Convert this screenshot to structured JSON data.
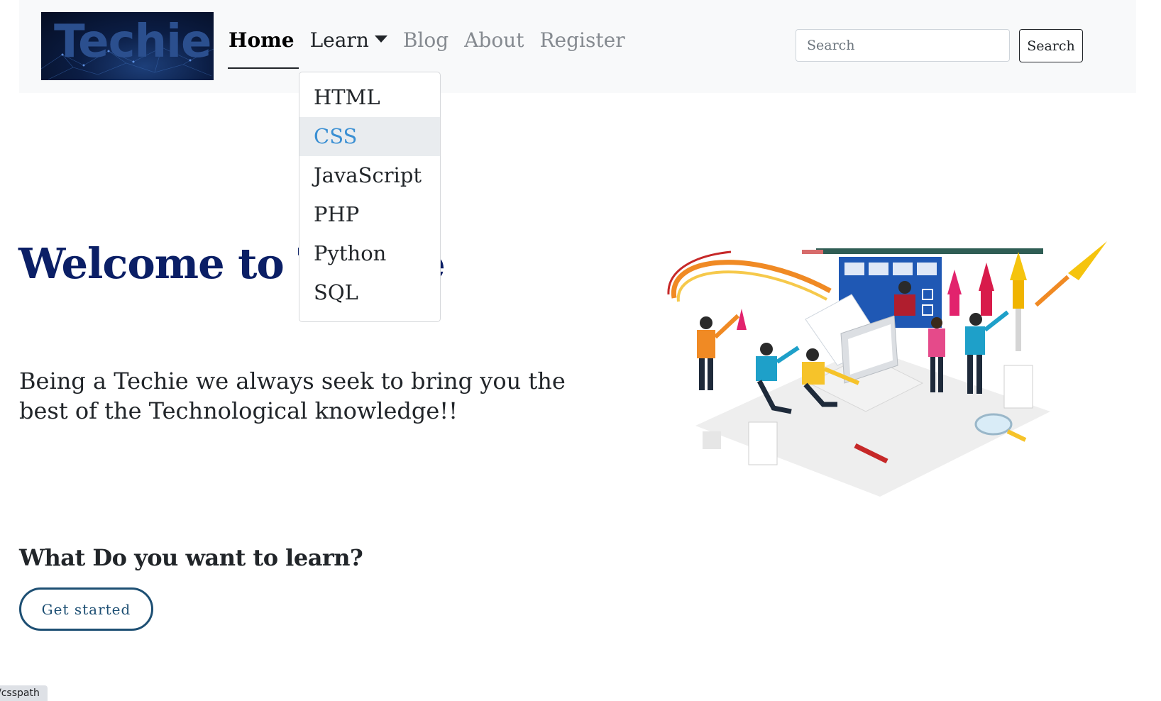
{
  "navbar": {
    "logo_text": "Techie",
    "links": [
      {
        "label": "Home"
      },
      {
        "label": "Learn"
      },
      {
        "label": "Blog"
      },
      {
        "label": "About"
      },
      {
        "label": "Register"
      }
    ],
    "search": {
      "placeholder": "Search",
      "button_label": "Search"
    }
  },
  "dropdown": {
    "items": [
      "HTML",
      "CSS",
      "JavaScript",
      "PHP",
      "Python",
      "SQL"
    ],
    "highlighted": "CSS"
  },
  "hero": {
    "title": "Welcome to Techie",
    "text": "Being a Techie we always seek to bring you the best of the Technological knowledge!!"
  },
  "cta": {
    "heading": "What Do you want to learn?",
    "button_label": "Get started"
  },
  "status_bar": {
    "url": "/csspath"
  },
  "colors": {
    "navbar_bg": "#f8f9fa",
    "title": "#0b1f66",
    "dropdown_active": "#3a8fd3",
    "cta_border": "#1d4f73"
  },
  "icons": {
    "dropdown_caret": "caret-down-icon"
  }
}
